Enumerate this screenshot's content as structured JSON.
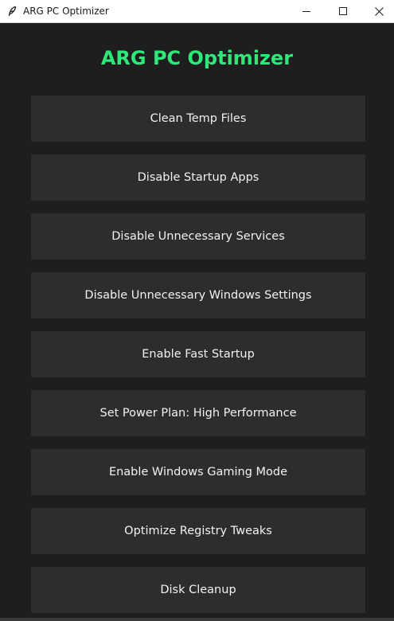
{
  "window": {
    "title": "ARG PC Optimizer",
    "app_icon": "feather-icon",
    "controls": [
      "minimize-icon",
      "maximize-icon",
      "close-icon"
    ]
  },
  "main": {
    "heading": "ARG PC Optimizer",
    "heading_color": "#2ee87a",
    "button_color": "#2d2d2d",
    "background_color": "#1e1e1e",
    "buttons": [
      "Clean Temp Files",
      "Disable Startup Apps",
      "Disable Unnecessary Services",
      "Disable Unnecessary Windows Settings",
      "Enable Fast Startup",
      "Set Power Plan: High Performance",
      "Enable Windows Gaming Mode",
      "Optimize Registry Tweaks",
      "Disk Cleanup"
    ]
  }
}
